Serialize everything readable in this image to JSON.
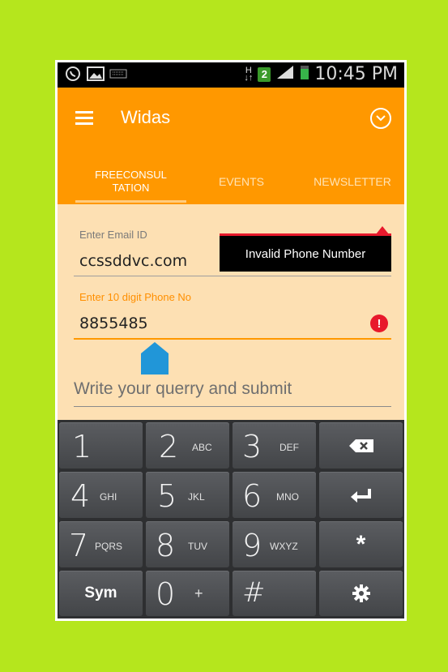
{
  "status_bar": {
    "time": "10:45 PM",
    "sim_badge": "2",
    "data_indicator": "H",
    "icons": [
      "whatsapp-icon",
      "gallery-icon",
      "keyboard-icon",
      "network-arrows-icon",
      "signal-icon",
      "battery-icon"
    ]
  },
  "app_bar": {
    "title": "Widas",
    "menu_icon": "hamburger-icon",
    "overflow_icon": "chevron-down-circle-icon",
    "background": "#ff9800"
  },
  "tabs": [
    {
      "label": "FREECONSUL\nTATION",
      "selected": true
    },
    {
      "label": "EVENTS",
      "selected": false
    },
    {
      "label": "NEWSLETTER",
      "selected": false
    }
  ],
  "form": {
    "email": {
      "label": "Enter Email ID",
      "value": "ccssddvc.com"
    },
    "phone": {
      "label": "Enter 10 digit Phone No",
      "value": "8855485"
    },
    "query": {
      "placeholder": "Write your querry and submit"
    },
    "error_tooltip": "Invalid Phone Number",
    "error_color": "#e8192c"
  },
  "keypad": {
    "rows": [
      [
        {
          "main": "1",
          "sub": ""
        },
        {
          "main": "2",
          "sub": "ABC"
        },
        {
          "main": "3",
          "sub": "DEF"
        },
        {
          "main": "",
          "sub": "",
          "icon": "backspace-icon"
        }
      ],
      [
        {
          "main": "4",
          "sub": "GHI"
        },
        {
          "main": "5",
          "sub": "JKL"
        },
        {
          "main": "6",
          "sub": "MNO"
        },
        {
          "main": "",
          "sub": "",
          "icon": "enter-icon"
        }
      ],
      [
        {
          "main": "7",
          "sub": "PQRS"
        },
        {
          "main": "8",
          "sub": "TUV"
        },
        {
          "main": "9",
          "sub": "WXYZ"
        },
        {
          "main": "*",
          "sub": ""
        }
      ],
      [
        {
          "main": "Sym",
          "sub": ""
        },
        {
          "main": "0",
          "sub": "+"
        },
        {
          "main": "#",
          "sub": ""
        },
        {
          "main": "",
          "sub": "",
          "icon": "settings-gear-icon"
        }
      ]
    ]
  }
}
